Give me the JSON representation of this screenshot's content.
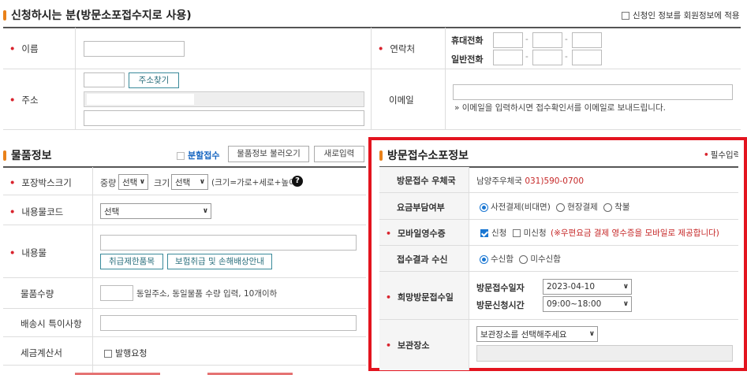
{
  "applicant": {
    "title": "신청하시는 분(방문소포접수지로 사용)",
    "save_to_member_label": "신청인 정보를 회원정보에 적용",
    "name_label": "이름",
    "contact_label": "연락처",
    "mobile_label": "휴대전화",
    "phone_label": "일반전화",
    "dash": "-",
    "address_label": "주소",
    "find_address_button": "주소찾기",
    "email_label": "이메일",
    "email_note": "» 이메일을 입력하시면 접수확인서를 이메일로 보내드립니다."
  },
  "goods": {
    "title": "물품정보",
    "split_label": "분할접수",
    "load_button": "물품정보 불러오기",
    "new_button": "새로입력",
    "box_size_label": "포장박스크기",
    "weight_label": "중량",
    "weight_value": "선택",
    "size_label": "크기",
    "size_value": "선택",
    "size_hint": "(크기=가로+세로+높이)",
    "help_icon_text": "?",
    "content_code_label": "내용물코드",
    "content_code_value": "선택",
    "content_label": "내용물",
    "restricted_button": "취급제한품목",
    "insurance_button": "보험취급 및 손해배상안내",
    "quantity_label": "물품수량",
    "quantity_hint": "동일주소, 동일물품 수량 입력, 10개이하",
    "delivery_note_label": "배송시 특이사항",
    "tax_label": "세금계산서",
    "tax_option": "발행요청"
  },
  "visit": {
    "title": "방문접수소포정보",
    "required_note": "필수입력",
    "office_label": "방문접수 우체국",
    "office_name": "남양주우체국",
    "office_phone": "031)590-0700",
    "fee_label": "요금부담여부",
    "fee_options": [
      "사전결제(비대면)",
      "현장결제",
      "착불"
    ],
    "fee_selected": 0,
    "receipt_label": "모바일영수증",
    "receipt_apply": "신청",
    "receipt_not_apply": "미신청",
    "receipt_note": "(※우편요금 결제 영수증을 모바일로 제공합니다)",
    "result_label": "접수결과 수신",
    "result_options": [
      "수신함",
      "미수신함"
    ],
    "result_selected": 0,
    "hope_label": "희망방문접수일",
    "date_label": "방문접수일자",
    "date_value": "2023-04-10",
    "time_label": "방문신청시간",
    "time_value": "09:00~18:00",
    "storage_label": "보관장소",
    "storage_placeholder": "보관장소를 선택해주세요"
  },
  "colors": {
    "accent": "#e9811a",
    "highlight_border": "#e3141f",
    "required": "#d9232d",
    "checkbox": "#1976d2"
  }
}
